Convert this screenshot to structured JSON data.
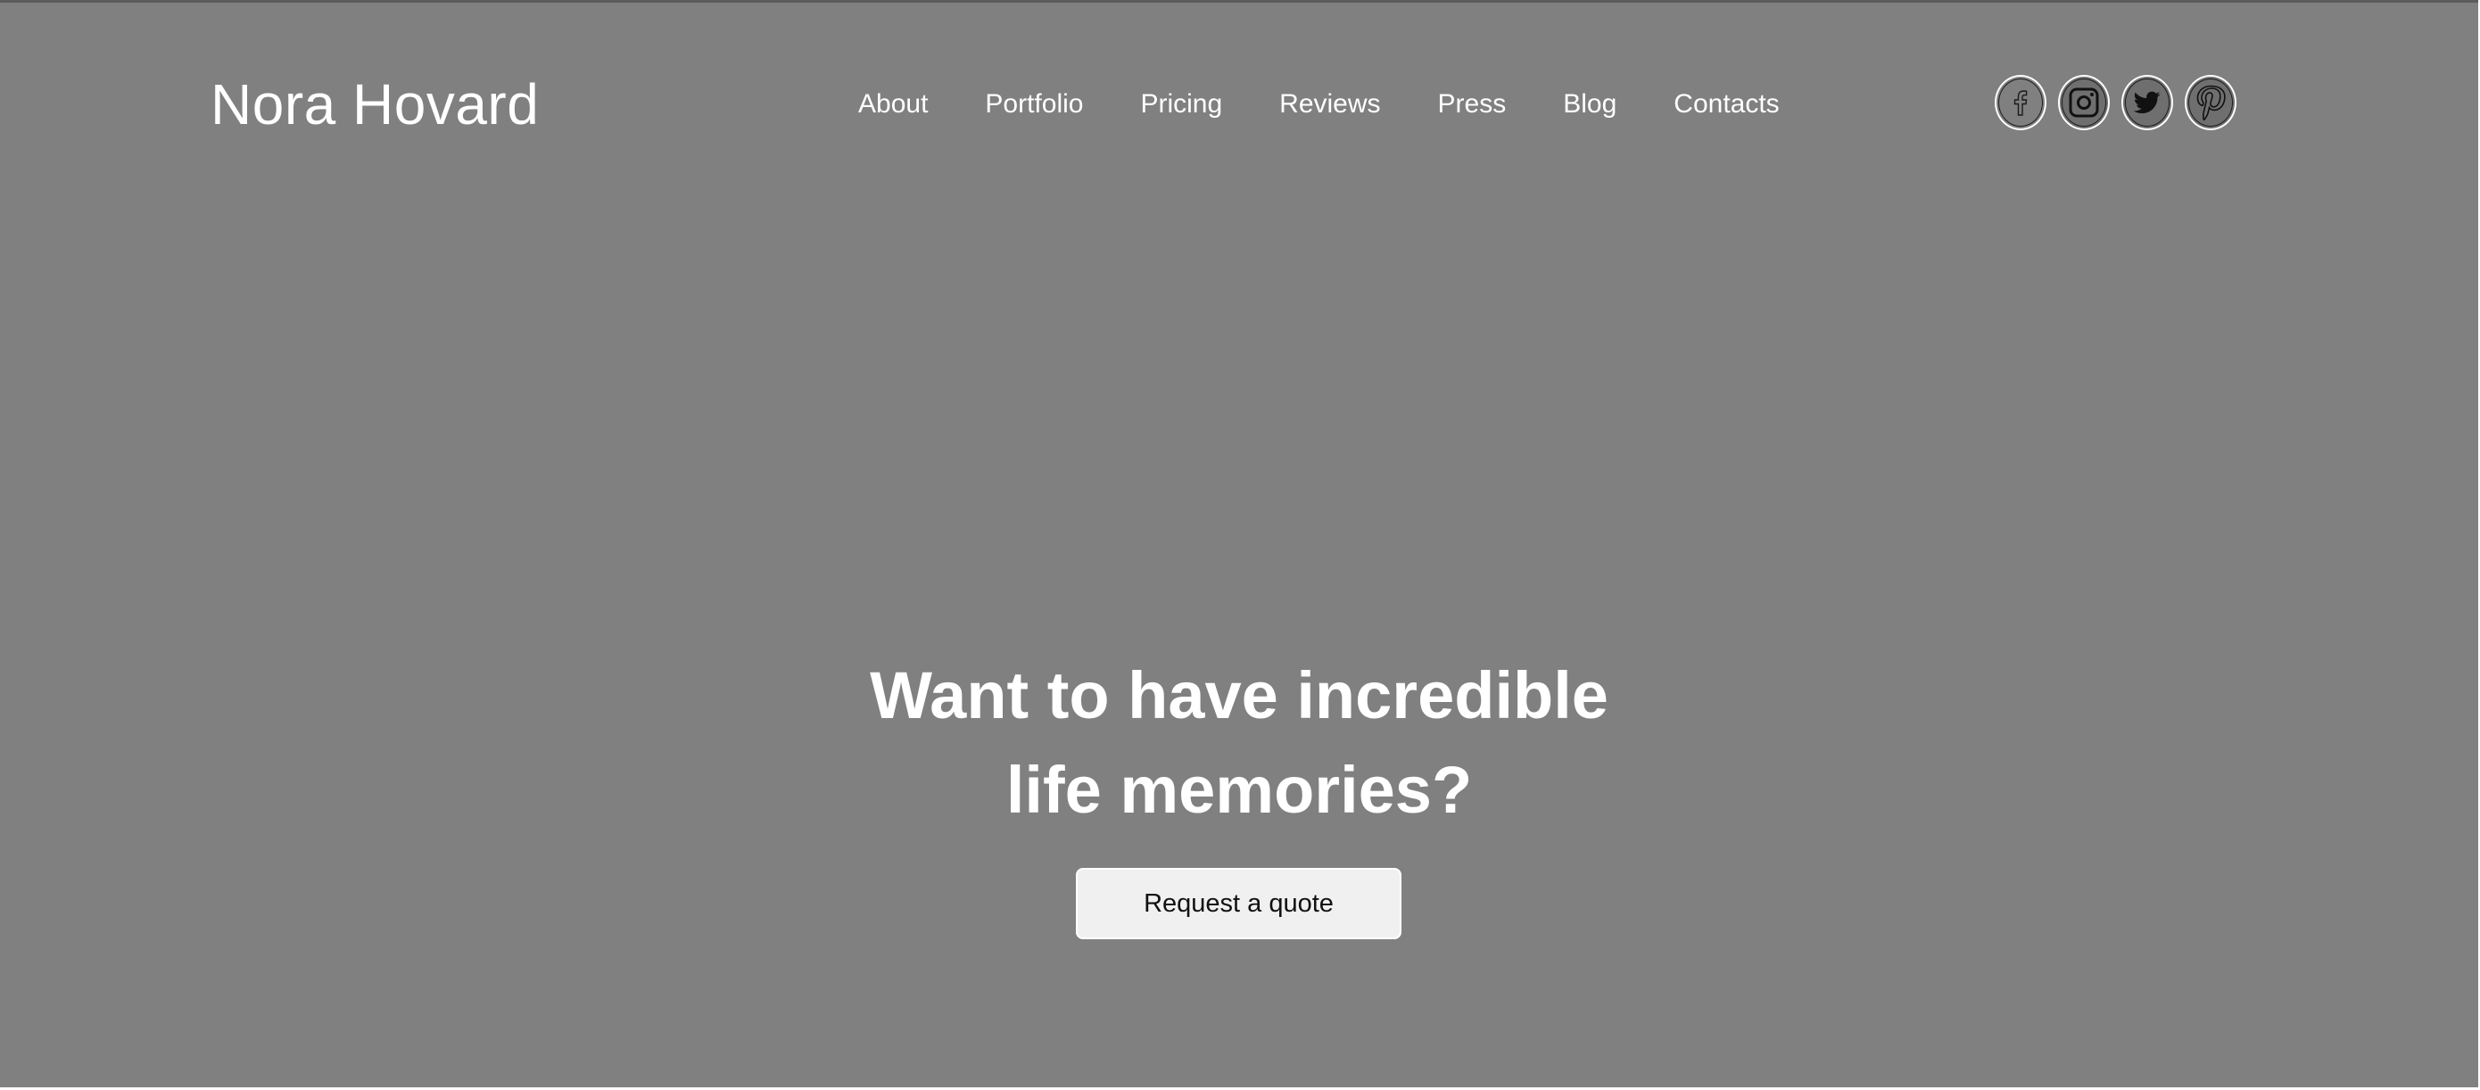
{
  "header": {
    "brand": "Nora Hovard",
    "nav": [
      "About",
      "Portfolio",
      "Pricing",
      "Reviews",
      "Press",
      "Blog",
      "Contacts"
    ],
    "social": [
      {
        "icon": "facebook-icon"
      },
      {
        "icon": "instagram-icon"
      },
      {
        "icon": "twitter-icon"
      },
      {
        "icon": "pinterest-icon"
      }
    ]
  },
  "hero": {
    "headline_line1": "Want to have incredible",
    "headline_line2": "life memories?",
    "cta_label": "Request a quote"
  },
  "colors": {
    "hero_background": "#808080",
    "text": "#ffffff",
    "button_background": "#f0f0f0",
    "button_text": "#111111"
  }
}
